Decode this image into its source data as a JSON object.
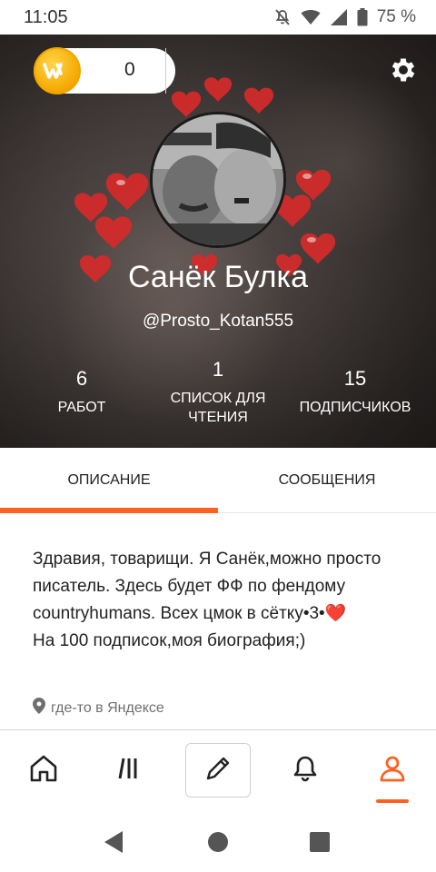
{
  "status_bar": {
    "time": "11:05",
    "battery_percent": "75 %",
    "icons": [
      "mute-icon",
      "wifi-icon",
      "signal-icon",
      "battery-icon"
    ]
  },
  "header": {
    "coins": {
      "count": "0",
      "add_label": "+"
    },
    "settings_icon": "gear-icon",
    "user": {
      "name": "Санёк Булка",
      "handle": "@Prosto_Kotan555"
    },
    "stats": [
      {
        "value": "6",
        "label": "РАБОТ"
      },
      {
        "value": "1",
        "label": "СПИСОК ДЛЯ ЧТЕНИЯ"
      },
      {
        "value": "15",
        "label": "ПОДПИСЧИКОВ"
      }
    ]
  },
  "tabs": [
    {
      "label": "ОПИСАНИЕ",
      "active": true
    },
    {
      "label": "СООБЩЕНИЯ",
      "active": false
    }
  ],
  "about": {
    "bio_line1": "Здравия, товарищи. Я Санёк,можно просто писатель. Здесь будет ФФ по фендому countryhumans. Всех цмок в сётку•3•❤️",
    "bio_line2": "На 100 подписок,моя биография;)",
    "location": "где-то в Яндексе"
  },
  "bottom_nav": [
    {
      "icon": "home-icon",
      "active": false
    },
    {
      "icon": "library-icon",
      "active": false
    },
    {
      "icon": "pencil-icon",
      "active": false
    },
    {
      "icon": "bell-icon",
      "active": false
    },
    {
      "icon": "profile-icon",
      "active": true
    }
  ],
  "colors": {
    "accent": "#ff6122",
    "coin": "#f5a800"
  }
}
